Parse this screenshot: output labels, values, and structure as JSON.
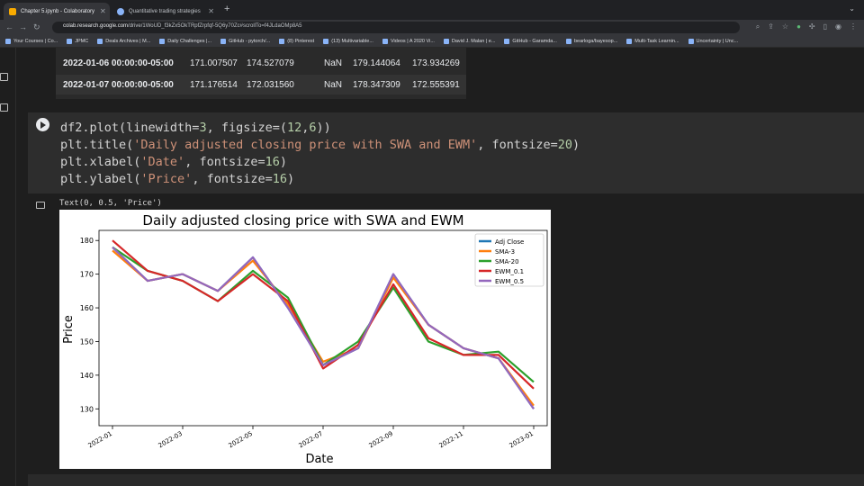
{
  "browser": {
    "tabs": [
      {
        "label": "Chapter 5.ipynb - Colaboratory",
        "active": true
      },
      {
        "label": "Quantitative trading strategies",
        "active": false
      }
    ],
    "url_host": "colab.research.google.com",
    "url_path": "/drive/1WoUD_f3kZx5OkTRpfZrpfqf-5Q6y70Zc#scrollTo=f4JLdaOMp8A5",
    "bookmarks": [
      "Your Courses | Co...",
      "JPMC",
      "Deals Archives | M...",
      "Daily Challenges |...",
      "GitHub - pytorch/...",
      "(8) Pinterest",
      "(13) Multivariable...",
      "Videos | A 2020 Vi...",
      "David J. Malan | e...",
      "GitHub - Garamda...",
      "bearloga/bayesop...",
      "Multi-Task Learnin...",
      "Uncertainty | Unc..."
    ]
  },
  "output_table": {
    "rows": [
      {
        "index": "2022-01-06 00:00:00-05:00",
        "values": [
          "171.007507",
          "174.527079",
          "NaN",
          "179.144064",
          "173.934269"
        ]
      },
      {
        "index": "2022-01-07 00:00:00-05:00",
        "values": [
          "171.176514",
          "172.031560",
          "NaN",
          "178.347309",
          "172.555391"
        ]
      }
    ]
  },
  "code": {
    "line1_a": "df2.plot(linewidth=",
    "line1_n1": "3",
    "line1_b": ", figsize=(",
    "line1_n2": "12",
    "line1_c": ",",
    "line1_n3": "6",
    "line1_d": "))",
    "line2_a": "plt.title(",
    "line2_s": "'Daily adjusted closing price with SWA and EWM'",
    "line2_b": ", fontsize=",
    "line2_n": "20",
    "line2_c": ")",
    "line3_a": "plt.xlabel(",
    "line3_s": "'Date'",
    "line3_b": ", fontsize=",
    "line3_n": "16",
    "line3_c": ")",
    "line4_a": "plt.ylabel(",
    "line4_s": "'Price'",
    "line4_b": ", fontsize=",
    "line4_n": "16",
    "line4_c": ")"
  },
  "output_text": "Text(0, 0.5, 'Price')",
  "chart_data": {
    "type": "line",
    "title": "Daily adjusted closing price with SWA and EWM",
    "xlabel": "Date",
    "ylabel": "Price",
    "x": [
      "2022-01",
      "2022-02",
      "2022-03",
      "2022-04",
      "2022-05",
      "2022-06",
      "2022-07",
      "2022-08",
      "2022-09",
      "2022-10",
      "2022-11",
      "2022-12",
      "2023-01"
    ],
    "xticks": [
      "2022-01",
      "2022-03",
      "2022-05",
      "2022-07",
      "2022-09",
      "2022-11",
      "2023-01"
    ],
    "yticks": [
      130,
      140,
      150,
      160,
      170,
      180
    ],
    "ylim": [
      125,
      183
    ],
    "legend_position": "upper right",
    "series": [
      {
        "name": "Adj Close",
        "color": "#1f77b4",
        "values": [
          178,
          168,
          170,
          165,
          175,
          160,
          143,
          148,
          170,
          155,
          148,
          145,
          130
        ]
      },
      {
        "name": "SMA-3",
        "color": "#ff7f0e",
        "values": [
          177,
          168,
          170,
          165,
          174,
          161,
          144,
          148,
          169,
          155,
          148,
          145,
          131
        ]
      },
      {
        "name": "SMA-20",
        "color": "#2ca02c",
        "values": [
          178,
          171,
          168,
          162,
          171,
          163,
          143,
          150,
          166,
          150,
          146,
          147,
          138
        ]
      },
      {
        "name": "EWM_0.1",
        "color": "#d62728",
        "values": [
          180,
          171,
          168,
          162,
          170,
          162,
          142,
          149,
          167,
          151,
          146,
          146,
          136
        ]
      },
      {
        "name": "EWM_0.5",
        "color": "#9467bd",
        "values": [
          178,
          168,
          170,
          165,
          175,
          160,
          143,
          148,
          170,
          155,
          148,
          145,
          130
        ]
      }
    ]
  }
}
